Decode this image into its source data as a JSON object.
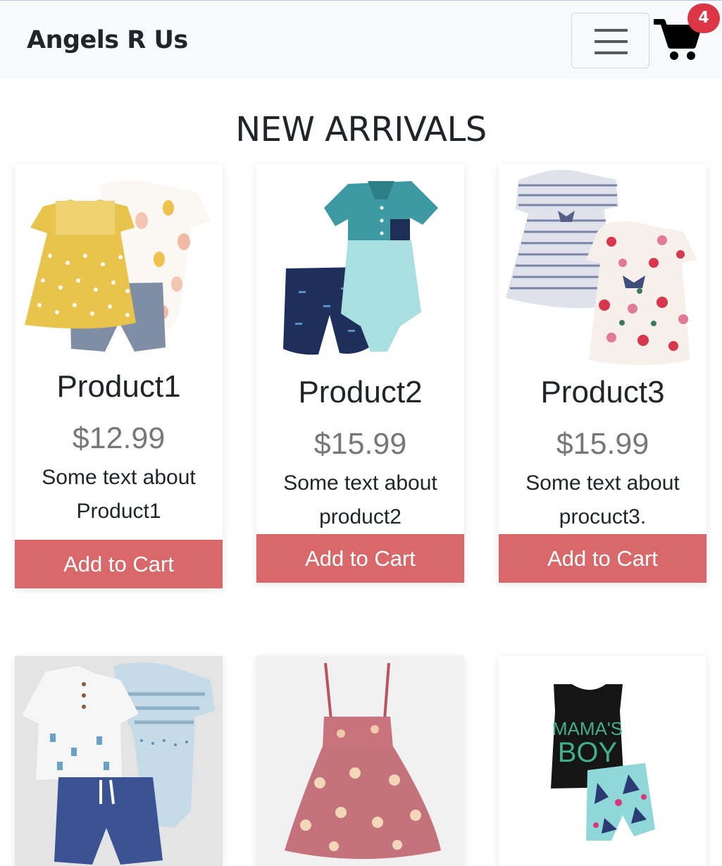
{
  "navbar": {
    "brand": "Angels R Us",
    "cart_count": "4"
  },
  "section_title": "NEW ARRIVALS",
  "products": [
    {
      "name": "Product1",
      "price": "$12.99",
      "desc_line1": "Some text about",
      "desc_line2": "Product1",
      "button": "Add to Cart"
    },
    {
      "name": "Product2",
      "price": "$15.99",
      "desc_line1": "Some text about",
      "desc_line2": "product2",
      "button": "Add to Cart"
    },
    {
      "name": "Product3",
      "price": "$15.99",
      "desc_line1": "Some text about",
      "desc_line2": "procuct3.",
      "button": "Add to Cart"
    }
  ],
  "second_row_text": [
    "MAMA'S",
    "BOY"
  ],
  "colors": {
    "accent": "#d9686a",
    "badge": "#dc3545",
    "navbar_bg": "#f8f9fa"
  },
  "icons": {
    "menu": "hamburger-icon",
    "cart": "shopping-cart-icon"
  }
}
